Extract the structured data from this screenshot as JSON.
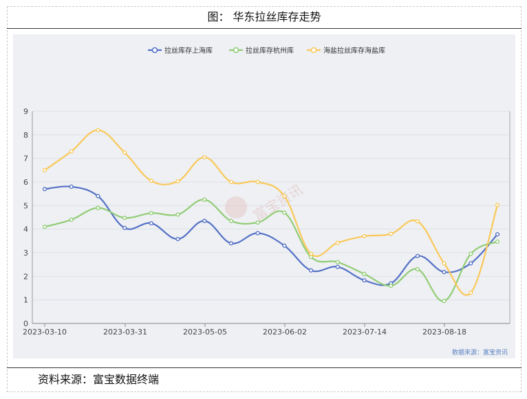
{
  "page": {
    "title": "图：  华东拉丝库存走势",
    "source": "资料来源：富宝数据终端",
    "watermark": "富宝资讯",
    "data_credit": "数据来源：富宝资讯"
  },
  "chart_data": {
    "type": "line",
    "title": "",
    "xlabel": "",
    "ylabel": "",
    "ylim": [
      0,
      9
    ],
    "yticks": [
      0,
      1,
      2,
      3,
      4,
      5,
      6,
      7,
      8,
      9
    ],
    "x_tick_labels": [
      "2023-03-10",
      "2023-03-31",
      "2023-05-05",
      "2023-06-02",
      "2023-07-14",
      "2023-08-18"
    ],
    "grid": true,
    "legend_position": "top-center",
    "series": [
      {
        "name": "拉丝库存上海库",
        "color": "#5470c6",
        "values": [
          5.7,
          5.8,
          5.4,
          4.05,
          4.25,
          3.58,
          4.35,
          3.4,
          3.83,
          3.3,
          2.25,
          2.4,
          1.83,
          1.7,
          2.86,
          2.18,
          2.55,
          3.78
        ]
      },
      {
        "name": "拉丝库存杭州库",
        "color": "#91cc75",
        "values": [
          4.1,
          4.4,
          4.9,
          4.48,
          4.68,
          4.62,
          5.25,
          4.35,
          4.28,
          4.7,
          2.82,
          2.6,
          2.1,
          1.6,
          2.3,
          0.95,
          2.95,
          3.47
        ]
      },
      {
        "name": "海盐拉丝库存海盐库",
        "color": "#fac858",
        "values": [
          6.5,
          7.3,
          8.2,
          7.25,
          6.05,
          6.03,
          7.05,
          6.0,
          6.0,
          5.4,
          2.95,
          3.42,
          3.7,
          3.8,
          4.33,
          2.55,
          1.3,
          5.02
        ]
      }
    ]
  }
}
